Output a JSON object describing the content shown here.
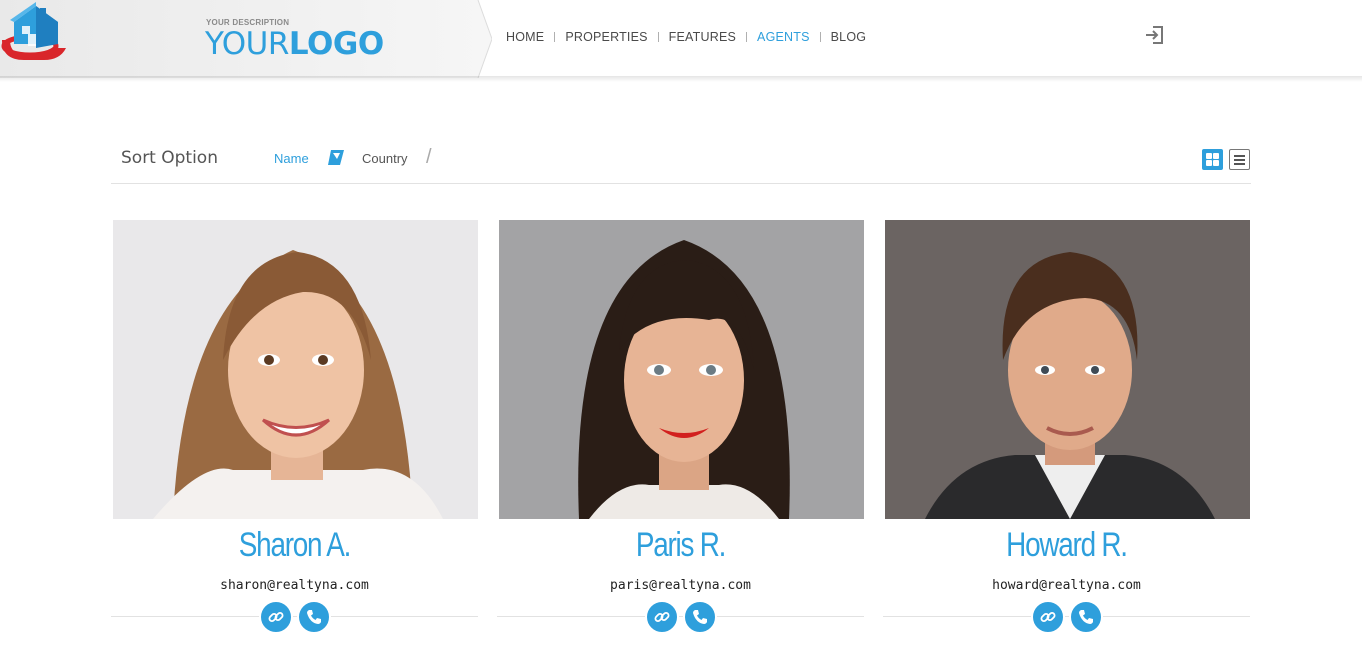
{
  "header": {
    "logo_description": "YOUR DESCRIPTION",
    "logo_word_your": "YOUR",
    "logo_word_logo": "LOGO",
    "nav": [
      {
        "label": "HOME",
        "active": false
      },
      {
        "label": "PROPERTIES",
        "active": false
      },
      {
        "label": "FEATURES",
        "active": false
      },
      {
        "label": "AGENTS",
        "active": true
      },
      {
        "label": "BLOG",
        "active": false
      }
    ],
    "login_icon": "sign-in-icon"
  },
  "sort": {
    "title": "Sort Option",
    "options": [
      "Name",
      "Country"
    ],
    "active_option": "Name",
    "view_modes": [
      "grid-view-icon",
      "list-view-icon"
    ],
    "active_view": "grid-view-icon"
  },
  "agents": [
    {
      "name": "Sharon A.",
      "email": "sharon@realtyna.com"
    },
    {
      "name": "Paris R.",
      "email": "paris@realtyna.com"
    },
    {
      "name": "Howard R.",
      "email": "howard@realtyna.com"
    }
  ],
  "colors": {
    "accent": "#2e9fdc",
    "text": "#555555",
    "divider": "#e2e2e2",
    "logo_red": "#d9262b"
  }
}
